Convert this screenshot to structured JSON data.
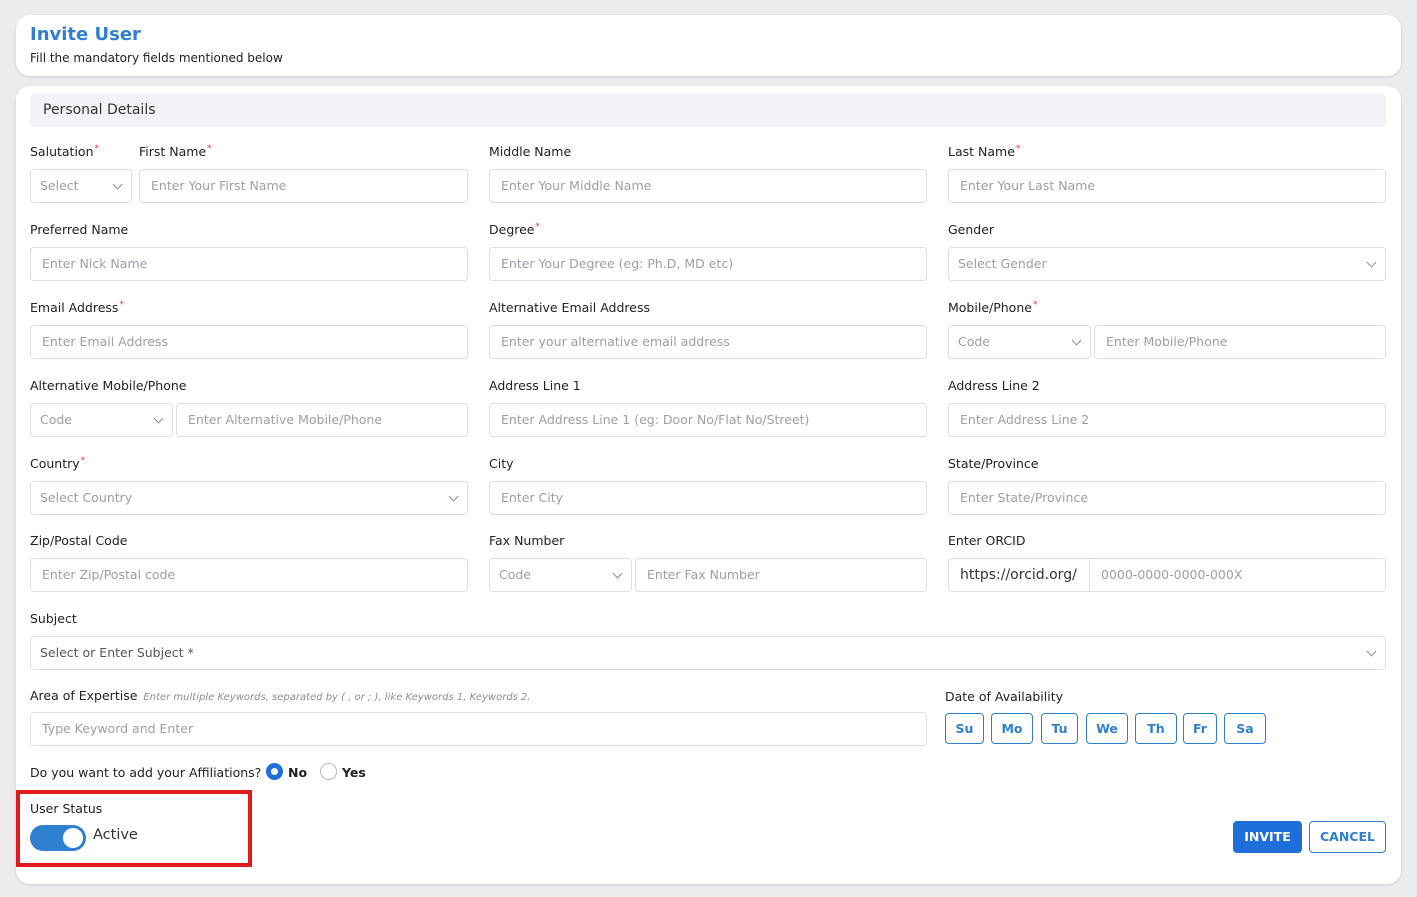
{
  "header": {
    "title": "Invite User",
    "subtitle": "Fill the mandatory fields mentioned below"
  },
  "section": {
    "title": "Personal Details"
  },
  "fields": {
    "salutation": {
      "label": "Salutation",
      "placeholder": "Select"
    },
    "first_name": {
      "label": "First Name",
      "placeholder": "Enter Your First Name"
    },
    "middle_name": {
      "label": "Middle Name",
      "placeholder": "Enter Your Middle Name"
    },
    "last_name": {
      "label": "Last Name",
      "placeholder": "Enter Your Last Name"
    },
    "preferred_name": {
      "label": "Preferred Name",
      "placeholder": "Enter Nick Name"
    },
    "degree": {
      "label": "Degree",
      "placeholder": "Enter Your Degree (eg: Ph.D, MD etc)"
    },
    "gender": {
      "label": "Gender",
      "placeholder": "Select Gender"
    },
    "email": {
      "label": "Email Address",
      "placeholder": "Enter Email Address"
    },
    "alt_email": {
      "label": "Alternative Email Address",
      "placeholder": "Enter your alternative email address"
    },
    "mobile": {
      "label": "Mobile/Phone",
      "code_placeholder": "Code",
      "placeholder": "Enter Mobile/Phone"
    },
    "alt_mobile": {
      "label": "Alternative Mobile/Phone",
      "code_placeholder": "Code",
      "placeholder": "Enter Alternative Mobile/Phone"
    },
    "address1": {
      "label": "Address Line 1",
      "placeholder": "Enter Address Line 1 (eg: Door No/Flat No/Street)"
    },
    "address2": {
      "label": "Address Line 2",
      "placeholder": "Enter Address Line 2"
    },
    "country": {
      "label": "Country",
      "placeholder": "Select Country"
    },
    "city": {
      "label": "City",
      "placeholder": "Enter City"
    },
    "state": {
      "label": "State/Province",
      "placeholder": "Enter State/Province"
    },
    "zip": {
      "label": "Zip/Postal Code",
      "placeholder": "Enter Zip/Postal code"
    },
    "fax": {
      "label": "Fax Number",
      "code_placeholder": "Code",
      "placeholder": "Enter Fax Number"
    },
    "orcid": {
      "label": "Enter ORCID",
      "prefix": "https://orcid.org/",
      "placeholder": "0000-0000-0000-000X"
    },
    "subject": {
      "label": "Subject",
      "placeholder": "Select or Enter Subject *"
    },
    "expertise": {
      "label": "Area of Expertise",
      "hint": "Enter multiple Keywords, separated by ( , or ; ), like Keywords 1, Keywords 2.",
      "placeholder": "Type Keyword and Enter"
    },
    "availability": {
      "label": "Date of Availability",
      "days": [
        "Su",
        "Mo",
        "Tu",
        "We",
        "Th",
        "Fr",
        "Sa"
      ]
    }
  },
  "affiliations": {
    "question": "Do you want to add your Affiliations?",
    "options": [
      "No",
      "Yes"
    ],
    "selected": "No"
  },
  "user_status": {
    "label": "User Status",
    "value": "Active",
    "enabled": true
  },
  "actions": {
    "invite": "INVITE",
    "cancel": "CANCEL"
  },
  "colors": {
    "accent": "#2f80d1",
    "primary_button": "#1e6fd9",
    "required": "#e53935",
    "highlight": "#e01b1b"
  }
}
